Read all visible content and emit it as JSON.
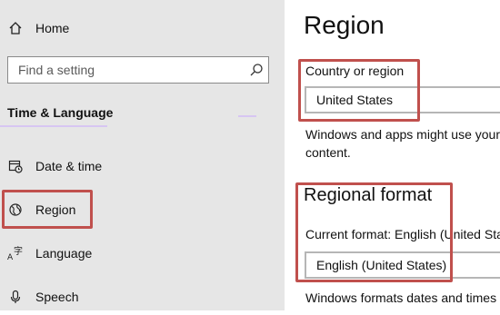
{
  "sidebar": {
    "home_label": "Home",
    "search_placeholder": "Find a setting",
    "section_heading": "Time & Language",
    "items": [
      {
        "label": "Date & time",
        "icon": "calendar-clock-icon"
      },
      {
        "label": "Region",
        "icon": "globe-icon"
      },
      {
        "label": "Language",
        "icon": "language-icon"
      },
      {
        "label": "Speech",
        "icon": "microphone-icon"
      }
    ]
  },
  "main": {
    "title": "Region",
    "country": {
      "label": "Country or region",
      "value": "United States",
      "description": "Windows and apps might use your content."
    },
    "regional_format": {
      "title": "Regional format",
      "current_format_label": "Current format: English (United Sta",
      "value": "English (United States)",
      "description": "Windows formats dates and times"
    }
  },
  "colors": {
    "sidebar_bg": "#e6e6e6",
    "highlight_border": "#c0504d"
  }
}
